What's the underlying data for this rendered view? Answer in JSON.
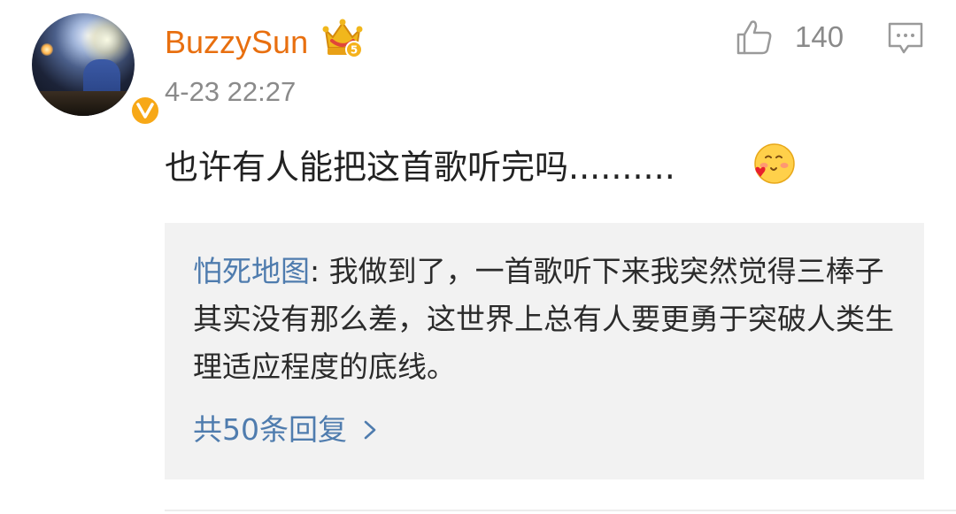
{
  "comment": {
    "username": "BuzzySun",
    "timestamp": "4-23 22:27",
    "like_count": "140",
    "text": "也许有人能把这首歌听完吗..........",
    "emoji_icon": "smiley-blush-heart-icon",
    "badge_icon": "vip-crown-icon",
    "verified_icon": "verified-v-icon"
  },
  "reply": {
    "author": "怕死地图",
    "separator": ": ",
    "text": "我做到了，一首歌听下来我突然觉得三棒子其实没有那么差，这世界上总有人要更勇于突破人类生理适应程度的底线。",
    "more_label": "共50条回复"
  },
  "colors": {
    "username": "#e86f0f",
    "link": "#4f7cae",
    "muted": "#8a8a8a",
    "reply_bg": "#f2f2f2",
    "verified": "#f7a817"
  }
}
